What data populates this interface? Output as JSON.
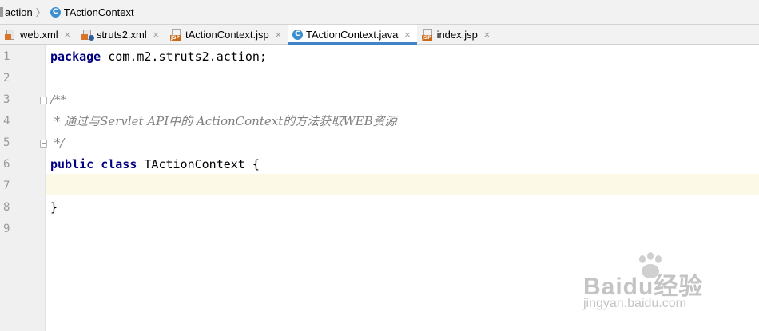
{
  "breadcrumb": {
    "package": "action",
    "class_icon": "C",
    "class_name": "TActionContext"
  },
  "tabs": [
    {
      "label": "web.xml",
      "icon": "xml-file-icon",
      "active": false
    },
    {
      "label": "struts2.xml",
      "icon": "xml-file-icon",
      "active": false
    },
    {
      "label": "tActionContext.jsp",
      "icon": "jsp-file-icon",
      "active": false
    },
    {
      "label": "TActionContext.java",
      "icon": "java-class-icon",
      "active": true
    },
    {
      "label": "index.jsp",
      "icon": "jsp-file-icon",
      "active": false
    }
  ],
  "tab_close_glyph": "×",
  "editor": {
    "line_numbers": [
      "1",
      "2",
      "3",
      "4",
      "5",
      "6",
      "7",
      "8",
      "9"
    ],
    "current_line": 7,
    "lines": {
      "l1_kw": "package",
      "l1_rest": " com.m2.struts2.action;",
      "l3": "/**",
      "l4": " * 通过与Servlet API中的 ActionContext的方法获取WEB资源",
      "l5": " */",
      "l6_kw": "public class",
      "l6_rest": " TActionContext {",
      "l8": "}"
    }
  },
  "watermark": {
    "brand": "Baidu经验",
    "url": "jingyan.baidu.com"
  },
  "colors": {
    "keyword": "#000080",
    "comment": "#808080",
    "active_tab_underline": "#4083c9",
    "current_line_bg": "#fcfae6",
    "class_icon": "#3d8fd0"
  }
}
